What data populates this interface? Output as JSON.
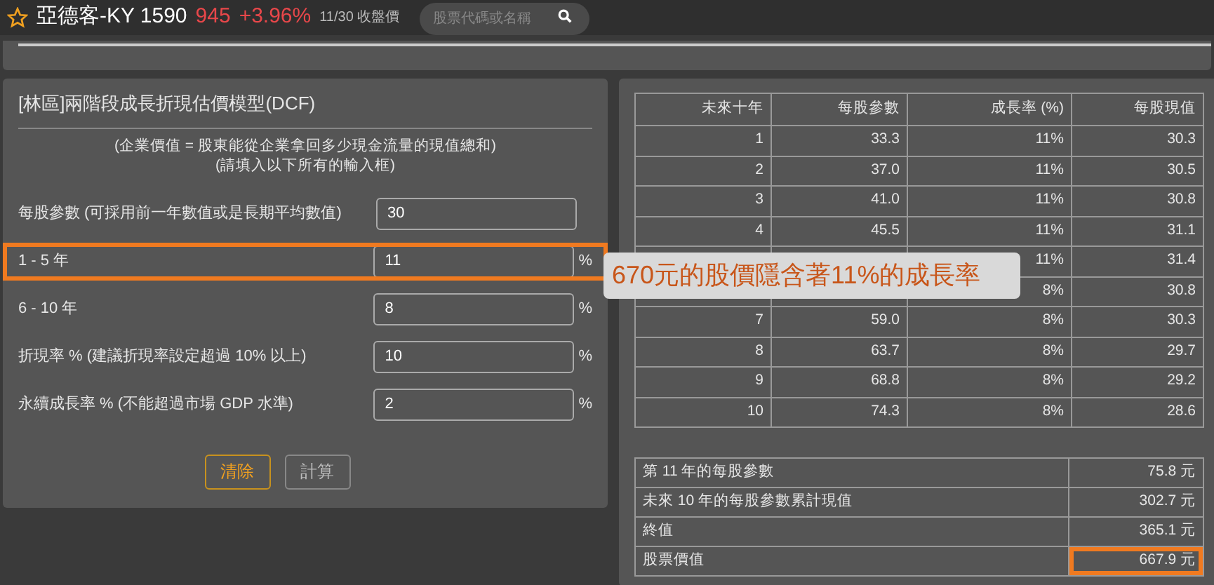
{
  "header": {
    "name": "亞德客-KY 1590",
    "price": "945",
    "change": "+3.96%",
    "date_note": "11/30 收盤價",
    "search": {
      "placeholder": "股票代碼或名稱"
    }
  },
  "form": {
    "title": "[林區]兩階段成長折現估價模型(DCF)",
    "notes": [
      "(企業價值 = 股東能從企業拿回多少現金流量的現值總和)",
      "(請填入以下所有的輸入框)"
    ],
    "fields": [
      {
        "label": "每股參數 (可採用前一年數值或是長期平均數值)",
        "value": "30",
        "highlighted": false
      },
      {
        "label": "1 - 5 年",
        "value": "11",
        "unit": "%",
        "highlighted": true
      },
      {
        "label": "6 - 10 年",
        "value": "8",
        "unit": "%",
        "highlighted": false
      },
      {
        "label": "折現率 % (建議折現率設定超過 10% 以上)",
        "value": "10",
        "unit": "%",
        "highlighted": false
      },
      {
        "label": "永續成長率 % (不能超過市場 GDP 水準)",
        "value": "2",
        "unit": "%",
        "highlighted": false
      }
    ],
    "buttons": [
      {
        "label": "清除",
        "kind": "primary"
      },
      {
        "label": "計算",
        "kind": "secondary"
      }
    ]
  },
  "table": {
    "columns": [
      "未來十年",
      "每股參數",
      "成長率 (%)",
      "每股現值"
    ],
    "rows": [
      [
        "1",
        "33.3",
        "11%",
        "30.3"
      ],
      [
        "2",
        "37.0",
        "11%",
        "30.5"
      ],
      [
        "3",
        "41.0",
        "11%",
        "30.8"
      ],
      [
        "4",
        "45.5",
        "11%",
        "31.1"
      ],
      [
        null,
        null,
        "11%",
        "31.4"
      ],
      [
        null,
        null,
        "8%",
        "30.8"
      ],
      [
        "7",
        "59.0",
        "8%",
        "30.3"
      ],
      [
        "8",
        "63.7",
        "8%",
        "29.7"
      ],
      [
        "9",
        "68.8",
        "8%",
        "29.2"
      ],
      [
        "10",
        "74.3",
        "8%",
        "28.6"
      ]
    ]
  },
  "summary": [
    {
      "label": "第 11 年的每股參數",
      "value": "75.8 元",
      "highlighted": false
    },
    {
      "label": "未來 10 年的每股參數累計現值",
      "value": "302.7 元",
      "highlighted": false
    },
    {
      "label": "終值",
      "value": "365.1 元",
      "highlighted": false
    },
    {
      "label": "股票價值",
      "value": "667.9 元",
      "highlighted": true
    }
  ],
  "callout": "670元的股價隱含著11%的成長率"
}
